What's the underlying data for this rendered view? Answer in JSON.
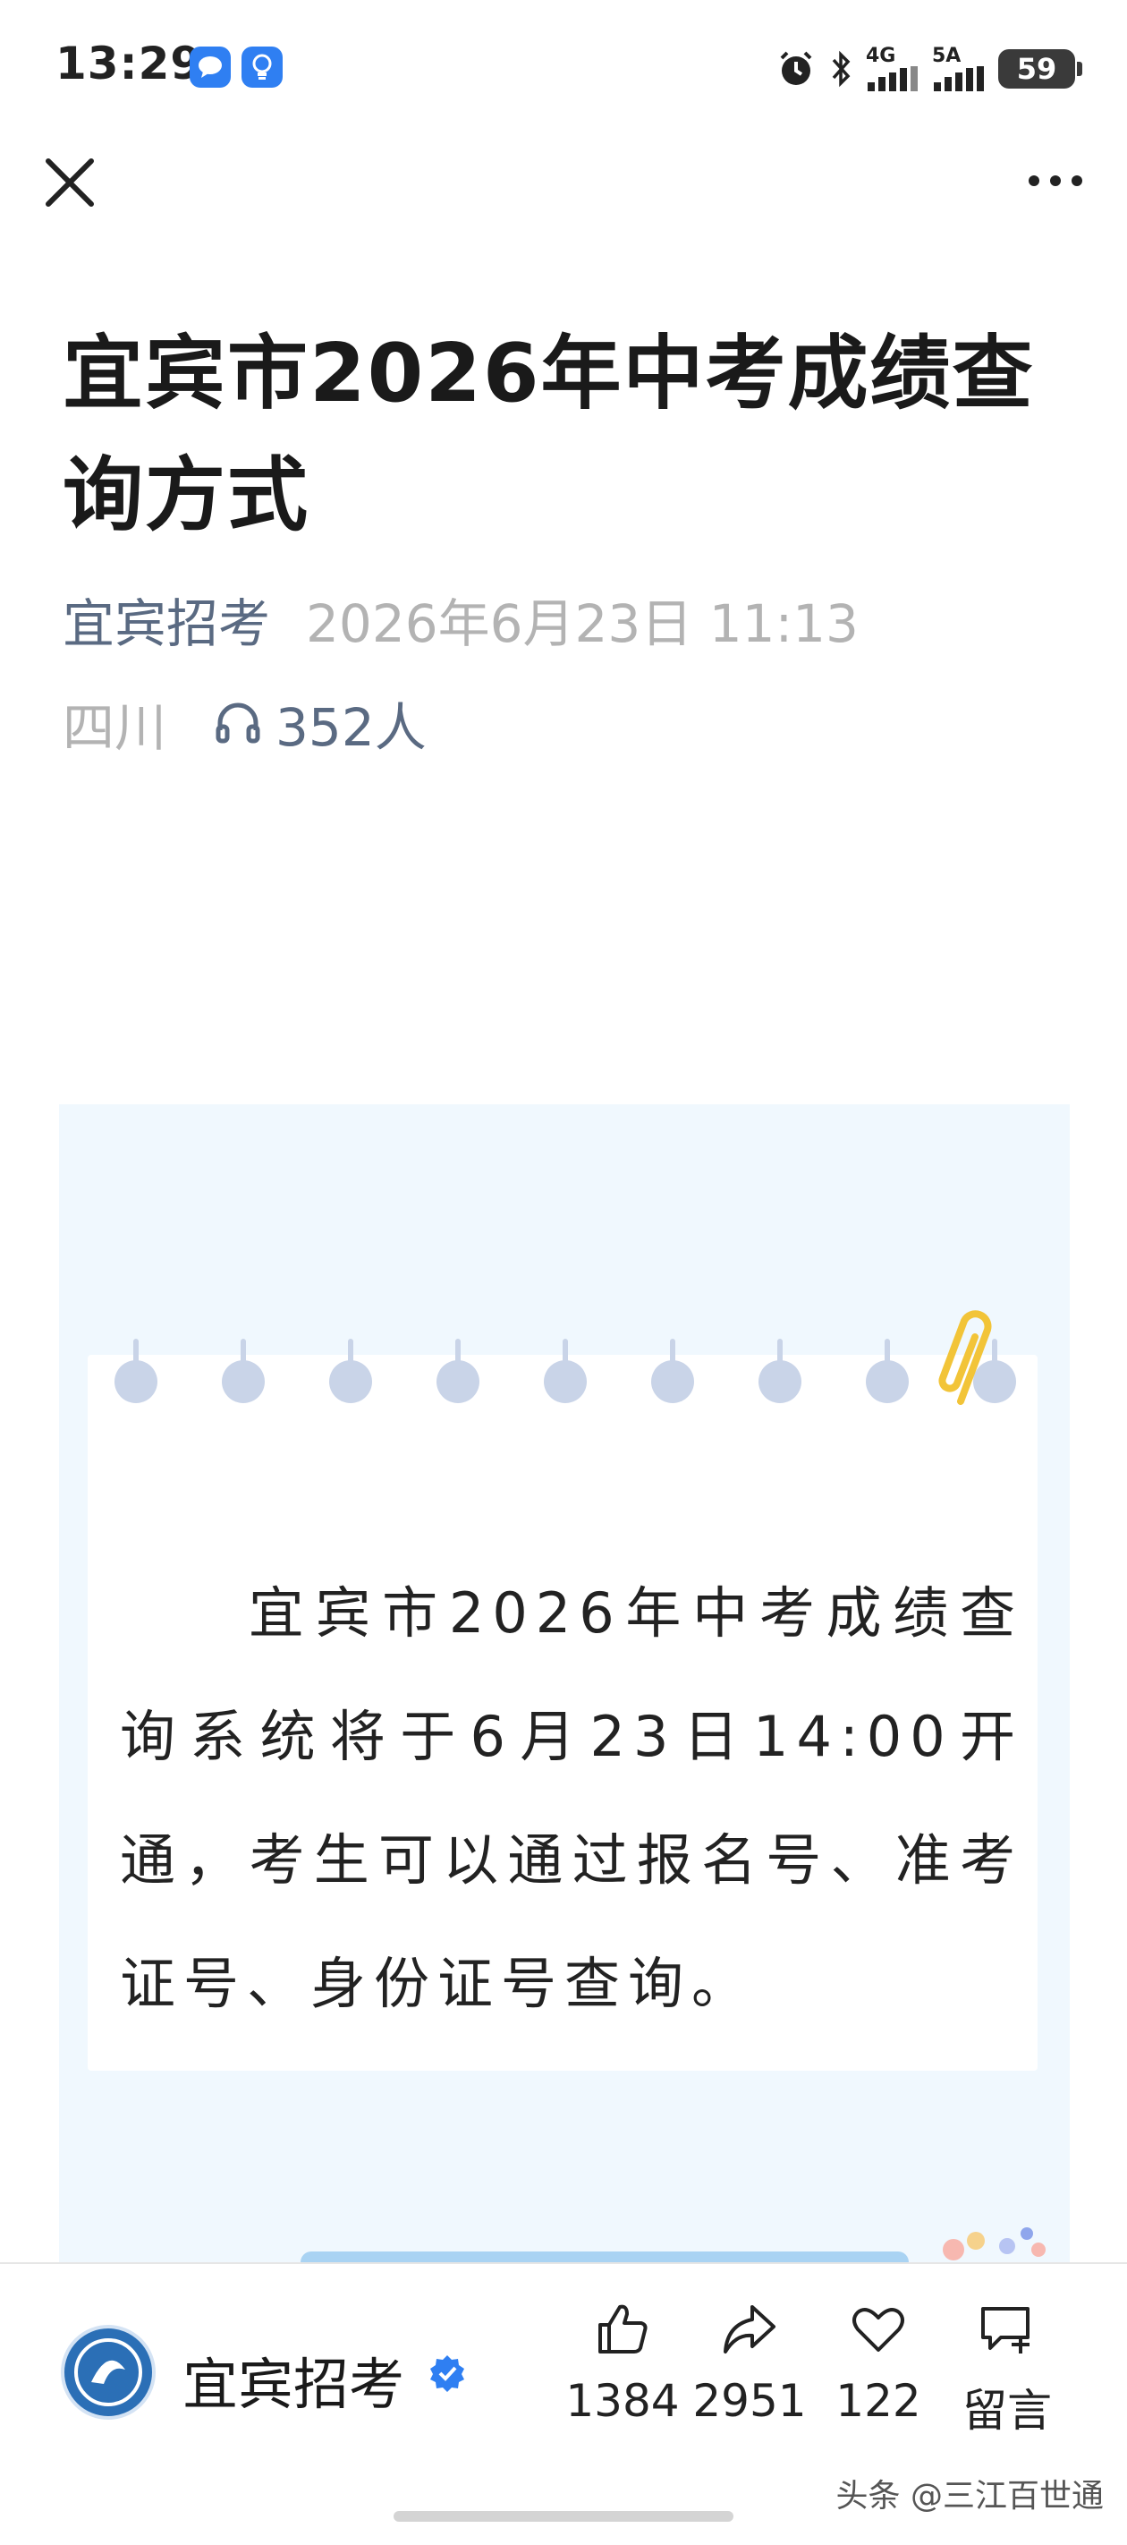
{
  "status_bar": {
    "time": "13:29",
    "network_1": "4G",
    "network_2": "5A",
    "battery": "59",
    "icons": [
      "message-icon",
      "bulb-icon",
      "alarm-icon",
      "bluetooth-icon",
      "signal-icon",
      "signal-icon"
    ]
  },
  "nav": {
    "close_icon": "close-icon",
    "more_icon": "more-icon"
  },
  "article": {
    "title": "宜宾市2026年中考成绩查询方式",
    "author": "宜宾招考",
    "date": "2026年6月23日 11:13",
    "region": "四川",
    "listeners": "352人"
  },
  "card": {
    "text": "宜宾市2026年中考成绩查询系统将于6月23日14:00开通，考生可以通过报名号、准考证号、身份证号查询。"
  },
  "bottom_bar": {
    "account_name": "宜宾招考",
    "likes": "1384",
    "shares": "2951",
    "favorites": "122",
    "comment_label": "留言",
    "watermark": "头条 @三江百世通"
  },
  "colors": {
    "accent": "#2f7ff2",
    "meta_author": "#5a6a82",
    "meta_muted": "#b3b3b3",
    "card_bg": "#f0f8fe"
  }
}
